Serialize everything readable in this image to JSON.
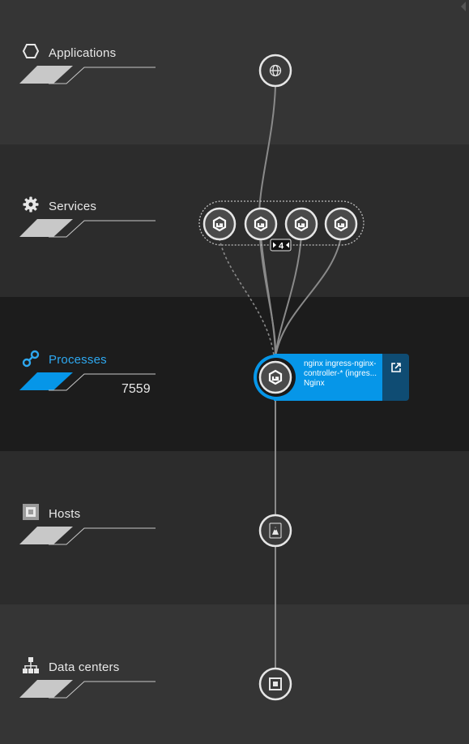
{
  "tiers": [
    {
      "label": "Applications",
      "icon": "hexagon-icon"
    },
    {
      "label": "Services",
      "icon": "gear-icon"
    },
    {
      "label": "Processes",
      "icon": "process-links-icon",
      "count": "7559",
      "selected": true
    },
    {
      "label": "Hosts",
      "icon": "host-icon"
    },
    {
      "label": "Data centers",
      "icon": "datacenter-icon"
    }
  ],
  "service_group": {
    "collapse_badge": "4"
  },
  "selected_process": {
    "line1": "nginx ingress-nginx-",
    "line2": "controller-* (ingres...",
    "line3": "Nginx"
  },
  "colors": {
    "accent": "#0696e8",
    "link_bg": "#0f4c73",
    "selected_label": "#2ea8f0"
  }
}
